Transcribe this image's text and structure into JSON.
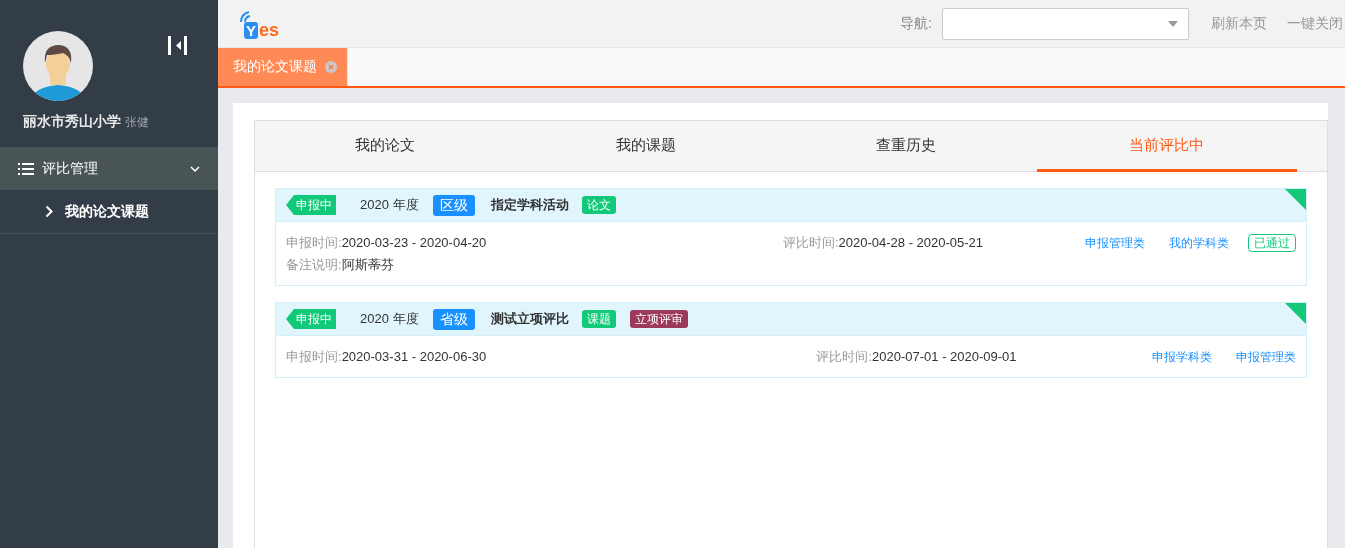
{
  "sidebar": {
    "user": {
      "school": "丽水市秀山小学",
      "name": "张健"
    },
    "menu": [
      {
        "label": "评比管理",
        "expanded": true,
        "children": [
          {
            "label": "我的论文课题"
          }
        ]
      }
    ]
  },
  "header": {
    "logo": [
      "Y",
      "es"
    ],
    "nav_label": "导航:",
    "actions": [
      "刷新本页",
      "一键关闭"
    ]
  },
  "page_tabs": [
    {
      "label": "我的论文课题",
      "selected": true
    }
  ],
  "tabs": [
    {
      "label": "我的论文",
      "selected": false
    },
    {
      "label": "我的课题",
      "selected": false
    },
    {
      "label": "查重历史",
      "selected": false
    },
    {
      "label": "当前评比中",
      "selected": true
    }
  ],
  "cards": [
    {
      "status": "申报中",
      "year": "2020 年度",
      "level": "区级",
      "title": "指定学科活动",
      "tags": [
        {
          "label": "论文",
          "color": "#12c97a"
        }
      ],
      "apply_label": "申报时间:",
      "apply_value": "2020-03-23 - 2020-04-20",
      "eval_label": "评比时间:",
      "eval_value": "2020-04-28 - 2020-05-21",
      "note_label": "备注说明:",
      "note_value": "阿斯蒂芬",
      "links": [
        "申报管理类",
        "我的学科类"
      ],
      "result": "已通过"
    },
    {
      "status": "申报中",
      "year": "2020 年度",
      "level": "省级",
      "title": "测试立项评比",
      "tags": [
        {
          "label": "课题",
          "color": "#12c97a"
        },
        {
          "label": "立项评审",
          "color": "#9b3a5c"
        }
      ],
      "apply_label": "申报时间:",
      "apply_value": "2020-03-31 - 2020-06-30",
      "eval_label": "评比时间:",
      "eval_value": "2020-07-01 - 2020-09-01",
      "links": [
        "申报学科类",
        "申报管理类"
      ]
    }
  ]
}
